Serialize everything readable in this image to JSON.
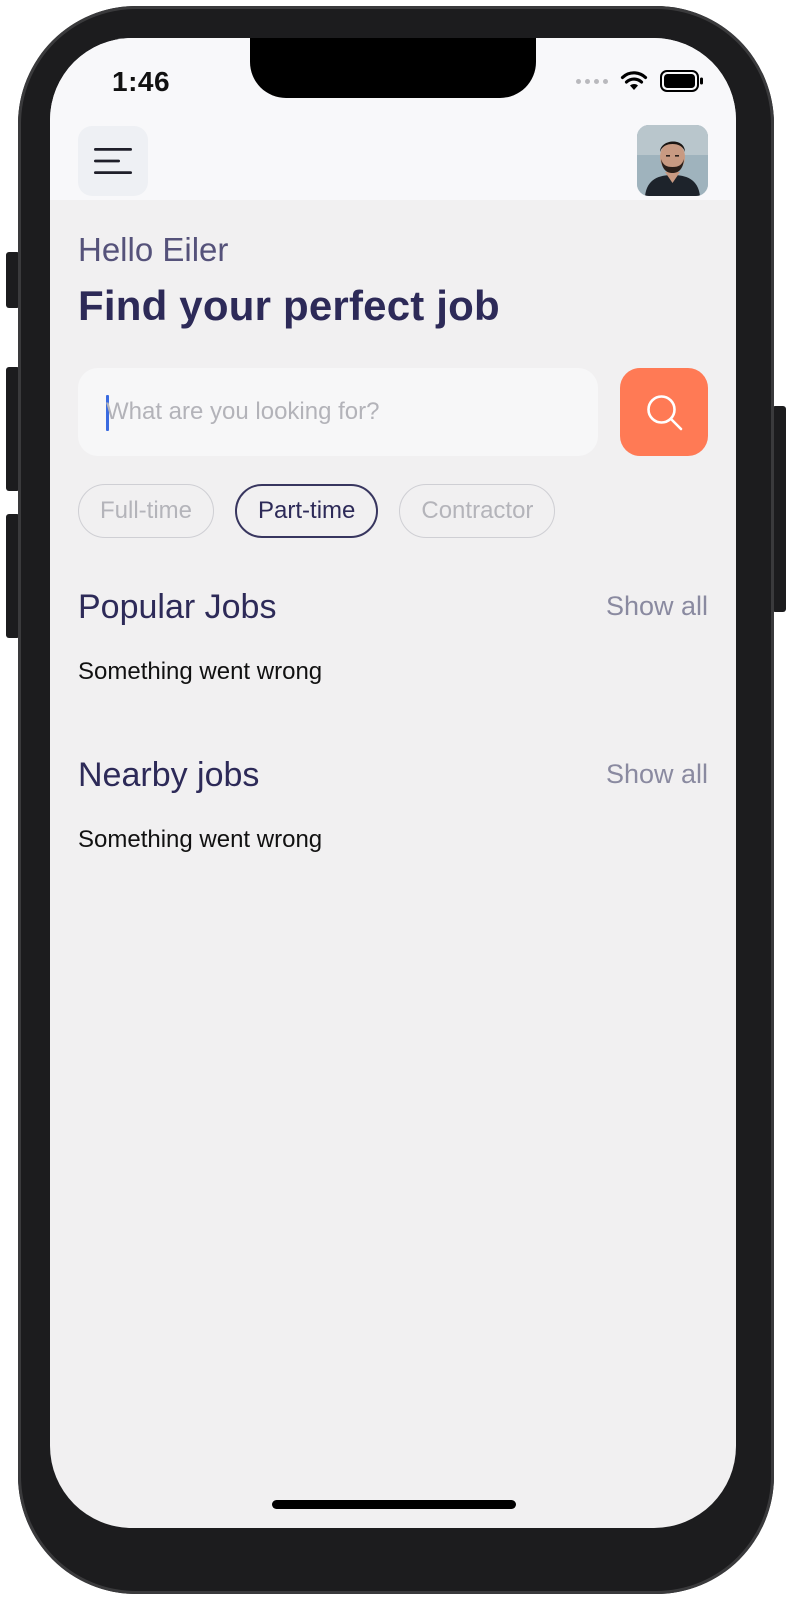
{
  "status_bar": {
    "time": "1:46"
  },
  "header": {
    "menu_icon": "hamburger-menu-icon",
    "avatar_alt": "profile avatar"
  },
  "greeting": "Hello Eiler",
  "headline": "Find your perfect job",
  "search": {
    "placeholder": "What are you looking for?",
    "value": "",
    "button_icon": "search-icon"
  },
  "job_types": [
    {
      "label": "Full-time",
      "active": false
    },
    {
      "label": "Part-time",
      "active": true
    },
    {
      "label": "Contractor",
      "active": false
    }
  ],
  "sections": {
    "popular": {
      "title": "Popular Jobs",
      "show_all": "Show all",
      "message": "Something went wrong"
    },
    "nearby": {
      "title": "Nearby jobs",
      "show_all": "Show all",
      "message": "Something went wrong"
    }
  },
  "colors": {
    "accent": "#ff7a55",
    "primary_text": "#2d2a58",
    "background": "#f1f0f1"
  }
}
